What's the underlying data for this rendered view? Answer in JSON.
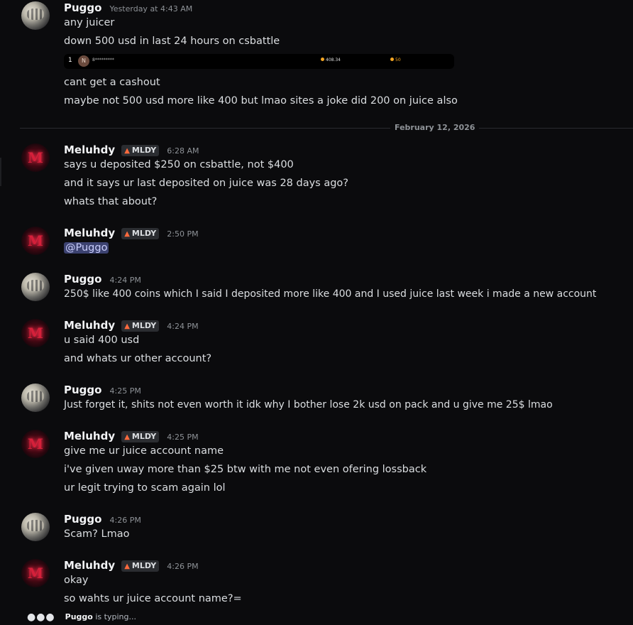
{
  "messages": [
    {
      "author": "Puggo",
      "time": "Yesterday at 4:43 AM",
      "lines": [
        "any juicer",
        "down 500 usd in last 24 hours on csbattle"
      ],
      "embed": {
        "rank": "1",
        "avatar_letter": "N",
        "username": "8*********",
        "amount": "408.34",
        "bet": "50"
      },
      "after_lines": [
        "cant get a cashout",
        "maybe not 500 usd more like 400 but lmao sites a joke did 200 on juice also"
      ]
    },
    {
      "author": "Meluhdy",
      "tag": "MLDY",
      "time": "6:28 AM",
      "lines": [
        "says u deposited $250 on csbattle, not $400",
        "and it says ur last deposited on juice was 28 days ago?",
        "whats that about?"
      ]
    },
    {
      "author": "Meluhdy",
      "tag": "MLDY",
      "time": "2:50 PM",
      "lines": [
        "@Puggo"
      ]
    },
    {
      "author": "Puggo",
      "time": "4:24 PM",
      "lines": [
        "250$ like 400 coins  which I said I deposited more like 400 and I used juice last week i made a new account"
      ]
    },
    {
      "author": "Meluhdy",
      "tag": "MLDY",
      "time": "4:24 PM",
      "lines": [
        "u said 400 usd",
        "and whats ur other account?"
      ]
    },
    {
      "author": "Puggo",
      "time": "4:25 PM",
      "lines": [
        "Just forget it, shits not even worth it idk why I bother lose 2k usd on pack and u give me 25$ lmao"
      ]
    },
    {
      "author": "Meluhdy",
      "tag": "MLDY",
      "time": "4:25 PM",
      "lines": [
        "give me ur juice account name",
        "i've given  uway more than $25 btw with me not even ofering lossback",
        "ur legit trying to scam again lol"
      ]
    },
    {
      "author": "Puggo",
      "time": "4:26 PM",
      "lines": [
        "Scam? Lmao"
      ]
    },
    {
      "author": "Meluhdy",
      "tag": "MLDY",
      "time": "4:26 PM",
      "lines": [
        "okay",
        "so wahts ur juice account name?="
      ]
    }
  ],
  "divider": {
    "label": "February 12, 2026"
  },
  "typing": {
    "user": "Puggo",
    "suffix": "is typing..."
  }
}
